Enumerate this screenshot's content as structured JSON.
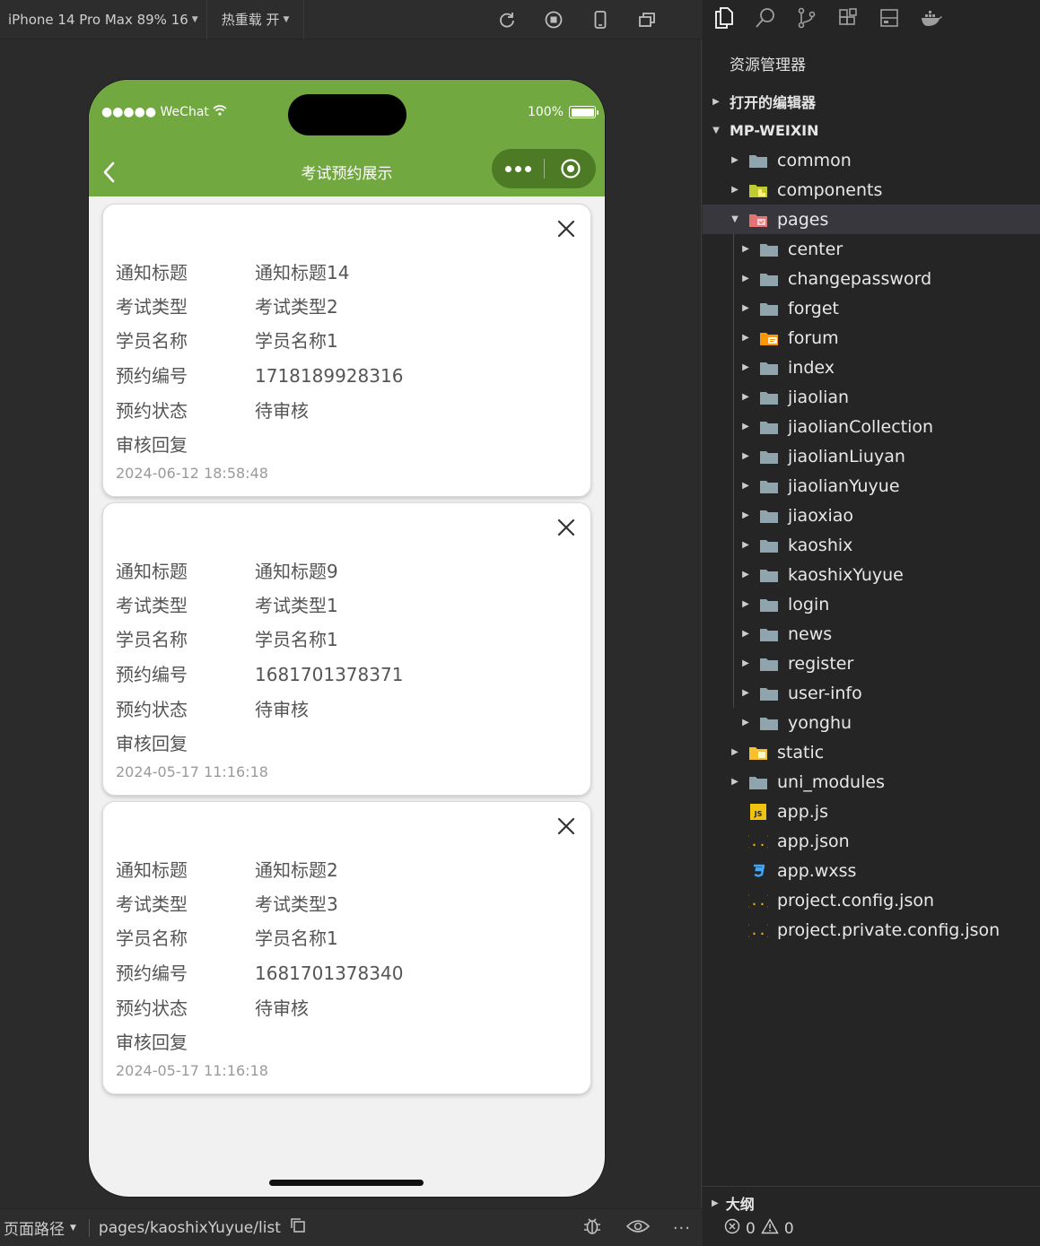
{
  "toolbar": {
    "device_label": "iPhone 14 Pro Max 89% 16",
    "hot_reload_label": "热重载 开"
  },
  "phone": {
    "status": {
      "carrier": "●●●●● WeChat",
      "battery": "100%",
      "battery_level": 1.0
    },
    "nav": {
      "title": "考试预约展示"
    },
    "cards": [
      {
        "rows": [
          {
            "label": "通知标题",
            "value": "通知标题14"
          },
          {
            "label": "考试类型",
            "value": "考试类型2"
          },
          {
            "label": "学员名称",
            "value": "学员名称1"
          },
          {
            "label": "预约编号",
            "value": "1718189928316"
          },
          {
            "label": "预约状态",
            "value": "待审核"
          },
          {
            "label": "审核回复",
            "value": ""
          }
        ],
        "time": "2024-06-12 18:58:48"
      },
      {
        "rows": [
          {
            "label": "通知标题",
            "value": "通知标题9"
          },
          {
            "label": "考试类型",
            "value": "考试类型1"
          },
          {
            "label": "学员名称",
            "value": "学员名称1"
          },
          {
            "label": "预约编号",
            "value": "1681701378371"
          },
          {
            "label": "预约状态",
            "value": "待审核"
          },
          {
            "label": "审核回复",
            "value": ""
          }
        ],
        "time": "2024-05-17 11:16:18"
      },
      {
        "rows": [
          {
            "label": "通知标题",
            "value": "通知标题2"
          },
          {
            "label": "考试类型",
            "value": "考试类型3"
          },
          {
            "label": "学员名称",
            "value": "学员名称1"
          },
          {
            "label": "预约编号",
            "value": "1681701378340"
          },
          {
            "label": "预约状态",
            "value": "待审核"
          },
          {
            "label": "审核回复",
            "value": ""
          }
        ],
        "time": "2024-05-17 11:16:18"
      }
    ]
  },
  "bottom_bar": {
    "path_label": "页面路径",
    "path_value": "pages/kaoshixYuyue/list"
  },
  "explorer": {
    "title": "资源管理器",
    "open_editors": "打开的编辑器",
    "project": "MP-WEIXIN",
    "tree": [
      {
        "name": "common",
        "depth": 1,
        "type": "folder",
        "expanded": false,
        "icon": "folder-icon"
      },
      {
        "name": "components",
        "depth": 1,
        "type": "folder",
        "expanded": false,
        "icon": "components-folder-icon"
      },
      {
        "name": "pages",
        "depth": 1,
        "type": "folder",
        "expanded": true,
        "icon": "pages-folder-icon"
      },
      {
        "name": "center",
        "depth": 2,
        "type": "folder",
        "expanded": false,
        "icon": "folder-icon"
      },
      {
        "name": "changepassword",
        "depth": 2,
        "type": "folder",
        "expanded": false,
        "icon": "folder-icon"
      },
      {
        "name": "forget",
        "depth": 2,
        "type": "folder",
        "expanded": false,
        "icon": "folder-icon"
      },
      {
        "name": "forum",
        "depth": 2,
        "type": "folder",
        "expanded": false,
        "icon": "forum-folder-icon"
      },
      {
        "name": "index",
        "depth": 2,
        "type": "folder",
        "expanded": false,
        "icon": "folder-icon"
      },
      {
        "name": "jiaolian",
        "depth": 2,
        "type": "folder",
        "expanded": false,
        "icon": "folder-icon"
      },
      {
        "name": "jiaolianCollection",
        "depth": 2,
        "type": "folder",
        "expanded": false,
        "icon": "folder-icon"
      },
      {
        "name": "jiaolianLiuyan",
        "depth": 2,
        "type": "folder",
        "expanded": false,
        "icon": "folder-icon"
      },
      {
        "name": "jiaolianYuyue",
        "depth": 2,
        "type": "folder",
        "expanded": false,
        "icon": "folder-icon"
      },
      {
        "name": "jiaoxiao",
        "depth": 2,
        "type": "folder",
        "expanded": false,
        "icon": "folder-icon"
      },
      {
        "name": "kaoshix",
        "depth": 2,
        "type": "folder",
        "expanded": false,
        "icon": "folder-icon"
      },
      {
        "name": "kaoshixYuyue",
        "depth": 2,
        "type": "folder",
        "expanded": false,
        "icon": "folder-icon"
      },
      {
        "name": "login",
        "depth": 2,
        "type": "folder",
        "expanded": false,
        "icon": "folder-icon"
      },
      {
        "name": "news",
        "depth": 2,
        "type": "folder",
        "expanded": false,
        "icon": "folder-icon"
      },
      {
        "name": "register",
        "depth": 2,
        "type": "folder",
        "expanded": false,
        "icon": "folder-icon"
      },
      {
        "name": "user-info",
        "depth": 2,
        "type": "folder",
        "expanded": false,
        "icon": "folder-icon"
      },
      {
        "name": "yonghu",
        "depth": 2,
        "type": "folder",
        "expanded": false,
        "icon": "folder-icon"
      },
      {
        "name": "static",
        "depth": 1,
        "type": "folder",
        "expanded": false,
        "icon": "static-folder-icon"
      },
      {
        "name": "uni_modules",
        "depth": 1,
        "type": "folder",
        "expanded": false,
        "icon": "folder-icon"
      },
      {
        "name": "app.js",
        "depth": 1,
        "type": "file",
        "icon": "js-file-icon"
      },
      {
        "name": "app.json",
        "depth": 1,
        "type": "file",
        "icon": "json-file-icon"
      },
      {
        "name": "app.wxss",
        "depth": 1,
        "type": "file",
        "icon": "css-file-icon"
      },
      {
        "name": "project.config.json",
        "depth": 1,
        "type": "file",
        "icon": "json-file-icon"
      },
      {
        "name": "project.private.config.json",
        "depth": 1,
        "type": "file",
        "icon": "json-file-icon"
      }
    ],
    "outline": "大纲",
    "errors": "0",
    "warnings": "0"
  },
  "colors": {
    "header_green": "#72a840",
    "capsule_green": "#4d7a25",
    "folder_gray": "#90a4ae",
    "json_yellow": "#f1c40f",
    "css_blue": "#42a5f5"
  }
}
